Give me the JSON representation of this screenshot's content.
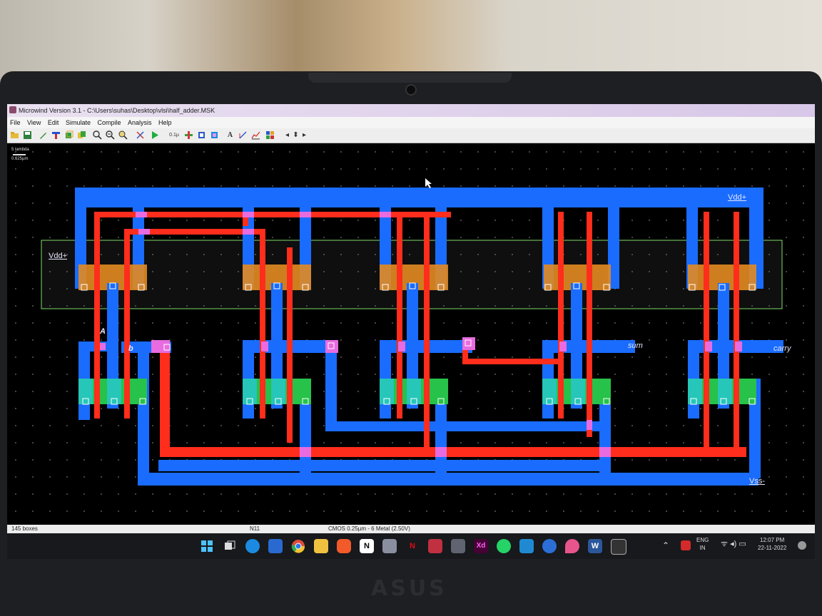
{
  "window": {
    "title": "Microwind Version 3.1 - C:\\Users\\suhas\\Desktop\\vlsi\\half_adder.MSK"
  },
  "menu": [
    "File",
    "View",
    "Edit",
    "Simulate",
    "Compile",
    "Analysis",
    "Help"
  ],
  "toolbar": {
    "icons": [
      "open-folder-icon",
      "save-icon",
      "pen-icon",
      "bus-icon",
      "layers-icon",
      "copy-icon",
      "zoom-in-icon",
      "zoom-out-icon",
      "zoom-fit-icon",
      "cut-icon",
      "run-simulation-icon",
      "nmos-icon",
      "contact-icon",
      "via-icon",
      "text-icon",
      "measure-icon",
      "graph-icon",
      "palette-icon",
      "arrow-left-icon",
      "arrow-up-down-icon",
      "arrow-right-icon"
    ],
    "zoom_label": "0.1µ",
    "text_tool": "A"
  },
  "canvas": {
    "scale_lambda": "5 lambda",
    "scale_um": "0.625µm",
    "labels": {
      "vdd_top": "Vdd+",
      "vdd_left": "Vdd+",
      "input_a": "A",
      "input_b": "b",
      "sum": "sum",
      "carry": "carry",
      "vss": "Vss-"
    },
    "colors": {
      "metal": "#1a6cff",
      "poly": "#ff2d1c",
      "n_diffusion": "#26c24a",
      "p_diffusion": "#e38b20",
      "contact": "#e86be0",
      "nwell_outline": "#7fdc6a"
    }
  },
  "status": {
    "boxes": "145 boxes",
    "node": "N11",
    "technology": "CMOS 0.25µm - 6 Metal (2.50V)"
  },
  "taskbar": {
    "apps": [
      "start-icon",
      "task-view-icon",
      "edge-icon",
      "ide-icon",
      "chrome-icon",
      "file-explorer-icon",
      "brave-icon",
      "notion-icon",
      "app-icon",
      "netflix-icon",
      "vector-icon",
      "calculator-icon",
      "adobe-xd-icon",
      "whatsapp-icon",
      "vscode-icon",
      "app2-icon",
      "drop-icon",
      "word-icon",
      "microwind-icon"
    ],
    "xd_label": "Xd",
    "word_label": "W",
    "netflix_label": "N",
    "language": "ENG",
    "region": "IN",
    "time": "12:07 PM",
    "date": "22-11-2022"
  }
}
